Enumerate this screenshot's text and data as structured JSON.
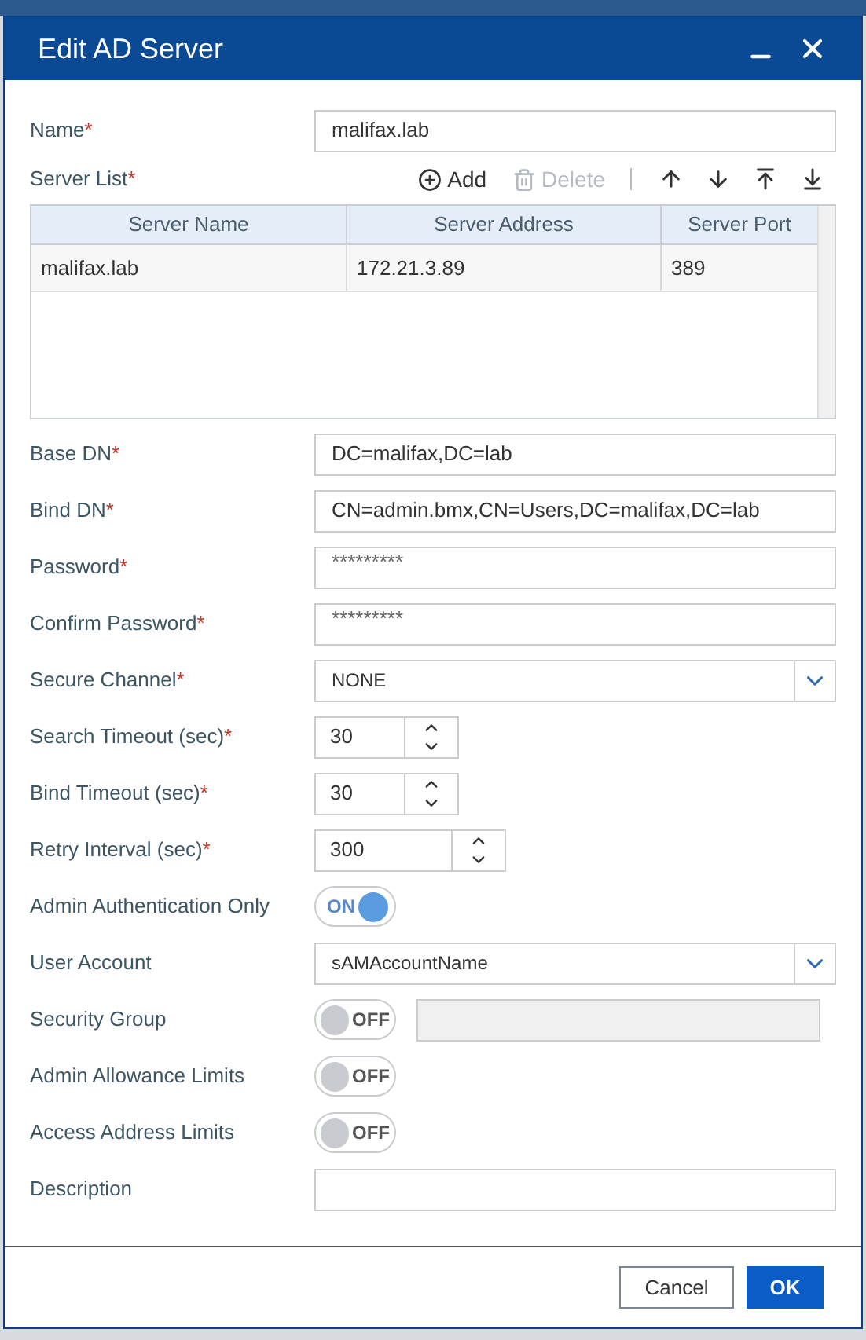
{
  "dialog": {
    "title": "Edit AD Server"
  },
  "name_field": {
    "label": "Name",
    "mark": "*",
    "value": "malifax.lab"
  },
  "server_list": {
    "label": "Server List",
    "mark": "*",
    "toolbar": [
      {
        "kind": "add",
        "label": "Add",
        "disabled": false
      },
      {
        "kind": "delete",
        "label": "Delete",
        "disabled": true
      },
      {
        "kind": "up",
        "disabled": false
      },
      {
        "kind": "down",
        "disabled": false
      },
      {
        "kind": "top",
        "disabled": false
      },
      {
        "kind": "bottom",
        "disabled": false
      }
    ],
    "columns": [
      "Server Name",
      "Server Address",
      "Server Port"
    ],
    "rows": [
      [
        "malifax.lab",
        "172.21.3.89",
        "389"
      ]
    ]
  },
  "fields": [
    {
      "kind": "text",
      "label": "Base DN",
      "mark": "*",
      "value": "DC=malifax,DC=lab"
    },
    {
      "kind": "text",
      "label": "Bind DN",
      "mark": "*",
      "value": "CN=admin.bmx,CN=Users,DC=malifax,DC=lab"
    },
    {
      "kind": "password",
      "label": "Password",
      "mark": "*",
      "value": "*********"
    },
    {
      "kind": "password",
      "label": "Confirm Password",
      "mark": "*",
      "value": "*********"
    },
    {
      "kind": "select",
      "label": "Secure Channel",
      "mark": "*",
      "value": "NONE"
    },
    {
      "kind": "spinner",
      "label": "Search Timeout (sec)",
      "mark": "*",
      "value": "30"
    },
    {
      "kind": "spinner",
      "label": "Bind Timeout (sec)",
      "mark": "*",
      "value": "30"
    },
    {
      "kind": "spinner_wide",
      "label": "Retry Interval (sec)",
      "mark": "*",
      "value": "300"
    },
    {
      "kind": "toggle",
      "label": "Admin Authentication Only",
      "on": true,
      "state_text": "ON"
    },
    {
      "kind": "select",
      "label": "User Account",
      "value": "sAMAccountName"
    },
    {
      "kind": "toggle_field",
      "label": "Security Group",
      "on": false,
      "state_text": "OFF"
    },
    {
      "kind": "toggle",
      "label": "Admin Allowance Limits",
      "on": false,
      "state_text": "OFF"
    },
    {
      "kind": "toggle",
      "label": "Access Address Limits",
      "on": false,
      "state_text": "OFF"
    },
    {
      "kind": "text",
      "label": "Description"
    }
  ],
  "buttons": [
    {
      "kind": "secondary",
      "label": "Cancel"
    },
    {
      "kind": "primary",
      "label": "OK"
    }
  ]
}
